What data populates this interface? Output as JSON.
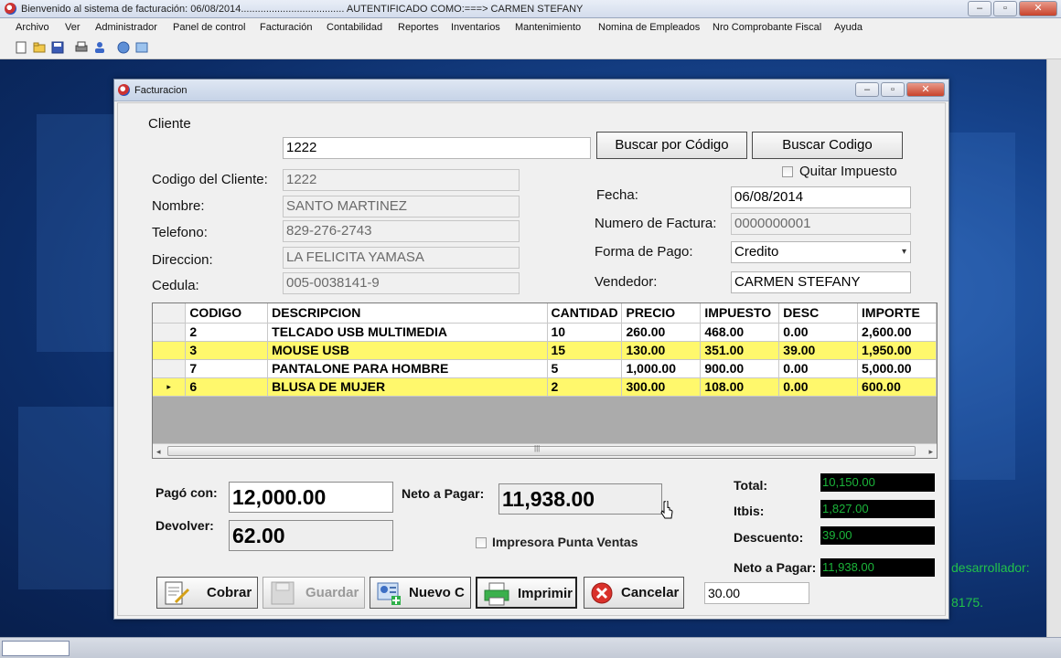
{
  "window": {
    "title": "Bienvenido al sistema de facturación: 06/08/2014..................................... AUTENTIFICADO COMO:===> CARMEN STEFANY",
    "min": "–",
    "max": "▫",
    "close": "✕"
  },
  "menu": [
    "Archivo",
    "Ver",
    "Administrador",
    "Panel de control",
    "Facturación",
    "Contabilidad",
    "Reportes",
    "Inventarios",
    "Mantenimiento",
    "Nomina de Empleados",
    "Nro Comprobante Fiscal",
    "Ayuda"
  ],
  "background": {
    "dev_line1": "desarrollador:",
    "dev_line2": "8175."
  },
  "dialog": {
    "title": "Facturacion",
    "min": "–",
    "max": "▫",
    "close": "✕"
  },
  "cliente": {
    "section_label": "Cliente",
    "search_value": "1222",
    "btn_buscar_por_codigo": "Buscar por Código",
    "btn_buscar_codigo": "Buscar Codigo",
    "quitar_impuesto": "Quitar Impuesto",
    "codigo_label": "Codigo del Cliente:",
    "codigo_value": "1222",
    "nombre_label": "Nombre:",
    "nombre_value": "SANTO MARTINEZ",
    "telefono_label": "Telefono:",
    "telefono_value": "829-276-2743",
    "direccion_label": "Direccion:",
    "direccion_value": "LA FELICITA YAMASA",
    "cedula_label": "Cedula:",
    "cedula_value": "005-0038141-9"
  },
  "factura": {
    "fecha_label": "Fecha:",
    "fecha_value": "06/08/2014",
    "numero_label": "Numero de Factura:",
    "numero_value": "0000000001",
    "forma_pago_label": "Forma de Pago:",
    "forma_pago_value": "Credito",
    "vendedor_label": "Vendedor:",
    "vendedor_value": "CARMEN STEFANY"
  },
  "grid": {
    "columns": [
      "CODIGO",
      "DESCRIPCION",
      "CANTIDAD",
      "PRECIO",
      "IMPUESTO",
      "DESC",
      "IMPORTE"
    ],
    "rows": [
      [
        "2",
        "TELCADO USB MULTIMEDIA",
        "10",
        "260.00",
        "468.00",
        "0.00",
        "2,600.00"
      ],
      [
        "3",
        "MOUSE USB",
        "15",
        "130.00",
        "351.00",
        "39.00",
        "1,950.00"
      ],
      [
        "7",
        "PANTALONE PARA HOMBRE",
        "5",
        "1,000.00",
        "900.00",
        "0.00",
        "5,000.00"
      ],
      [
        "6",
        "BLUSA DE MUJER",
        "2",
        "300.00",
        "108.00",
        "0.00",
        "600.00"
      ]
    ],
    "current_row_marker": "▸",
    "scroll_left": "◂",
    "scroll_right": "▸",
    "scroll_grip": "|||"
  },
  "pago": {
    "pago_con_label": "Pagó con:",
    "pago_con_value": "12,000.00",
    "devolver_label": "Devolver:",
    "devolver_value": "62.00",
    "neto_label": "Neto a Pagar:",
    "neto_value": "11,938.00",
    "impresora_label": "Impresora Punta Ventas"
  },
  "totales": {
    "total_label": "Total:",
    "total_value": "10,150.00",
    "itbis_label": "Itbis:",
    "itbis_value": "1,827.00",
    "descuento_label": "Descuento:",
    "descuento_value": "39.00",
    "neto_label": "Neto a Pagar:",
    "neto_value": "11,938.00"
  },
  "actions": {
    "cobrar": "Cobrar",
    "guardar": "Guardar",
    "nuevo": "Nuevo C",
    "imprimir": "Imprimir",
    "cancelar": "Cancelar",
    "extra_value": "30.00"
  }
}
